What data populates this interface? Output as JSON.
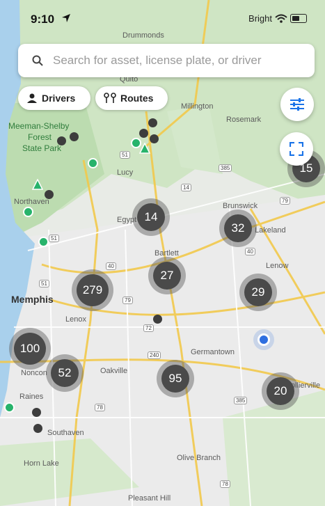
{
  "status_bar": {
    "time": "9:10",
    "carrier": "Bright"
  },
  "search": {
    "placeholder": "Search for asset, license plate, or driver"
  },
  "filters": {
    "drivers_label": "Drivers",
    "routes_label": "Routes"
  },
  "icons": {
    "location_arrow": "location-arrow-icon",
    "search": "search-icon",
    "driver": "person-icon",
    "routes": "route-icon",
    "filter": "sliders-icon",
    "expand": "expand-icon"
  },
  "colors": {
    "accent": "#1a73e8",
    "cluster": "#4a4a4a",
    "driver_dot": "#27b36b",
    "user_location": "#2f6fe0"
  },
  "clusters": [
    "15",
    "14",
    "32",
    "27",
    "279",
    "29",
    "100",
    "52",
    "95",
    "20"
  ],
  "map_labels": {
    "drummonds": "Drummonds",
    "quito": "Quito",
    "millington": "Millington",
    "rosemark": "Rosemark",
    "meeman": "Meeman-Shelby",
    "forest": "Forest",
    "state_park": "State Park",
    "lucy": "Lucy",
    "northaven": "Northaven",
    "egypt": "Egypt",
    "brunswick": "Brunswick",
    "lakeland": "Lakeland",
    "bartlett": "Bartlett",
    "lenow": "Lenow",
    "memphis": "Memphis",
    "lenox": "Lenox",
    "germantown": "Germantown",
    "noncon": "Noncon",
    "oakville": "Oakville",
    "collierville": "Collierville",
    "raines": "Raines",
    "southaven": "Southaven",
    "horn_lake": "Horn Lake",
    "olive_branch": "Olive Branch",
    "pleasant_hill": "Pleasant Hill"
  },
  "road_shields": [
    "51",
    "385",
    "14",
    "79",
    "51",
    "40",
    "40",
    "51",
    "79",
    "72",
    "240",
    "385",
    "78",
    "78"
  ]
}
